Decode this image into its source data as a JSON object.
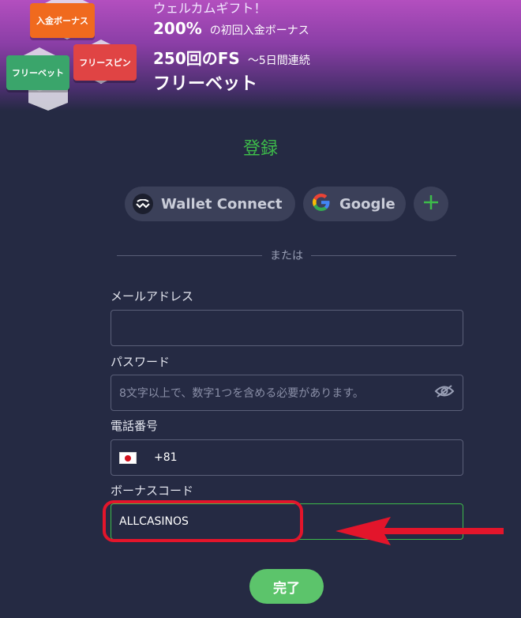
{
  "banner": {
    "tile_deposit": "入金ボーナス",
    "tile_freespin": "フリースピン",
    "tile_freebet": "フリーベット",
    "welcome": "ウェルカムギフト！",
    "line1_big": "200%",
    "line1_small": "の初回入金ボーナス",
    "line2_big": "250回のFS",
    "line2_small": "～5日間連続",
    "line3": "フリーベット"
  },
  "title": "登録",
  "social": {
    "wallet_connect": "Wallet Connect",
    "google": "Google",
    "more": "+"
  },
  "divider": "または",
  "form": {
    "email_label": "メールアドレス",
    "email_value": "",
    "password_label": "パスワード",
    "password_placeholder": "8文字以上で、数字1つを含める必要があります。",
    "phone_label": "電話番号",
    "phone_code": "+81",
    "bonus_label": "ボーナスコード",
    "bonus_value": "ALLCASINOS",
    "submit": "完了"
  },
  "colors": {
    "background": "#252a43",
    "accent_green": "#3dbb4a",
    "highlight_red": "#e3152b"
  },
  "icons": [
    "walletconnect-icon",
    "google-icon",
    "plus-icon",
    "eye-off-icon",
    "japan-flag-icon",
    "arrow-left-icon"
  ]
}
